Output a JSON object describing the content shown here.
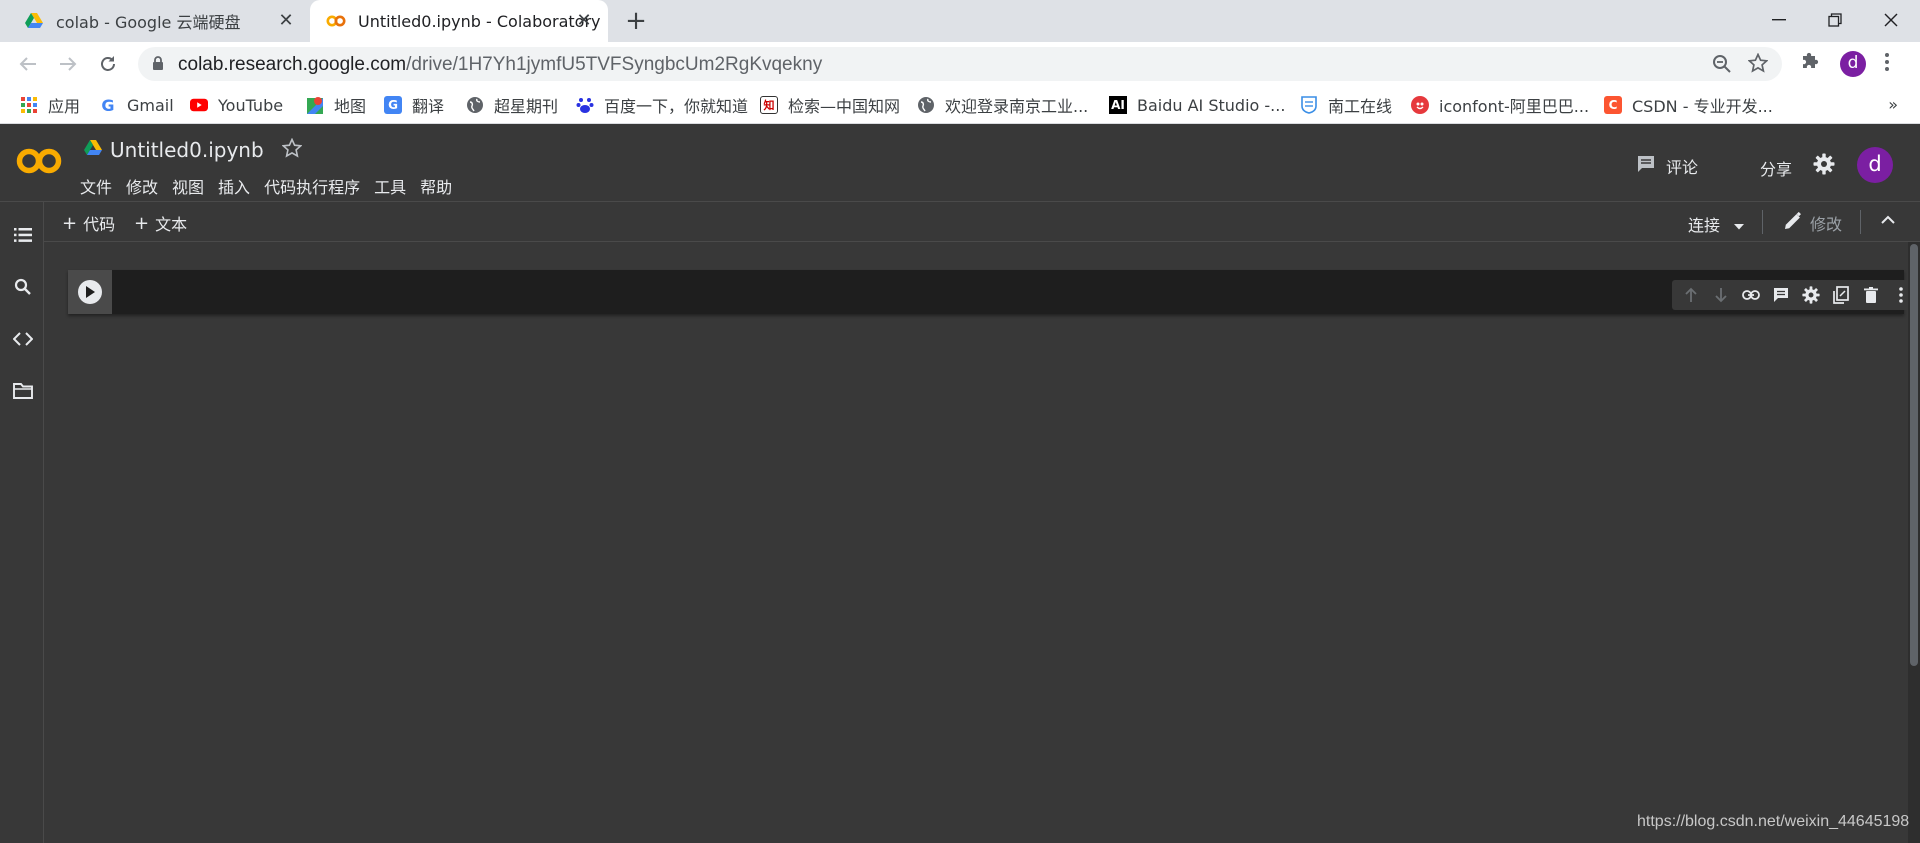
{
  "browser": {
    "tabs": [
      {
        "title": "colab - Google 云端硬盘",
        "icon": "google-drive-icon",
        "active": false
      },
      {
        "title": "Untitled0.ipynb - Colaboratory",
        "icon": "colab-icon",
        "active": true
      }
    ],
    "address": {
      "host": "colab.research.google.com",
      "path": "/drive/1H7Yh1jymfU5TVFSyngbcUm2RgKvqekny"
    },
    "profile_initial": "d",
    "bookmarks": [
      {
        "label": "应用",
        "icon": "apps-grid-icon"
      },
      {
        "label": "Gmail",
        "icon": "google-icon"
      },
      {
        "label": "YouTube",
        "icon": "youtube-icon"
      },
      {
        "label": "地图",
        "icon": "maps-icon"
      },
      {
        "label": "翻译",
        "icon": "translate-icon"
      },
      {
        "label": "超星期刊",
        "icon": "globe-icon"
      },
      {
        "label": "百度一下，你就知道",
        "icon": "baidu-paw-icon"
      },
      {
        "label": "检索—中国知网",
        "icon": "cnki-icon"
      },
      {
        "label": "欢迎登录南京工业...",
        "icon": "globe-icon"
      },
      {
        "label": "Baidu AI Studio -...",
        "icon": "ai-studio-icon"
      },
      {
        "label": "南工在线",
        "icon": "njtech-icon"
      },
      {
        "label": "iconfont-阿里巴巴...",
        "icon": "iconfont-icon"
      },
      {
        "label": "CSDN - 专业开发...",
        "icon": "csdn-icon"
      }
    ],
    "bookmarks_more": "»"
  },
  "colab": {
    "notebook_title": "Untitled0.ipynb",
    "menu": [
      "文件",
      "修改",
      "视图",
      "插入",
      "代码执行程序",
      "工具",
      "帮助"
    ],
    "comment_label": "评论",
    "share_label": "分享",
    "user_initial": "d",
    "toolbar": {
      "add_code": "代码",
      "add_text": "文本",
      "connect": "连接",
      "edit": "修改"
    },
    "rail_icons": [
      "table-of-contents-icon",
      "search-icon",
      "code-snippets-icon",
      "files-folder-icon"
    ],
    "cell_toolbar_icons": [
      "move-up-icon",
      "move-down-icon",
      "link-icon",
      "comment-icon",
      "settings-icon",
      "mirror-cell-icon",
      "delete-icon",
      "more-vert-icon"
    ]
  },
  "watermark": "https://blog.csdn.net/weixin_44645198",
  "colors": {
    "colab_orange": "#f9ab00",
    "avatar_purple": "#7b1fa2",
    "dark_bg": "#383838",
    "cell_bg": "#1e1e1e"
  }
}
